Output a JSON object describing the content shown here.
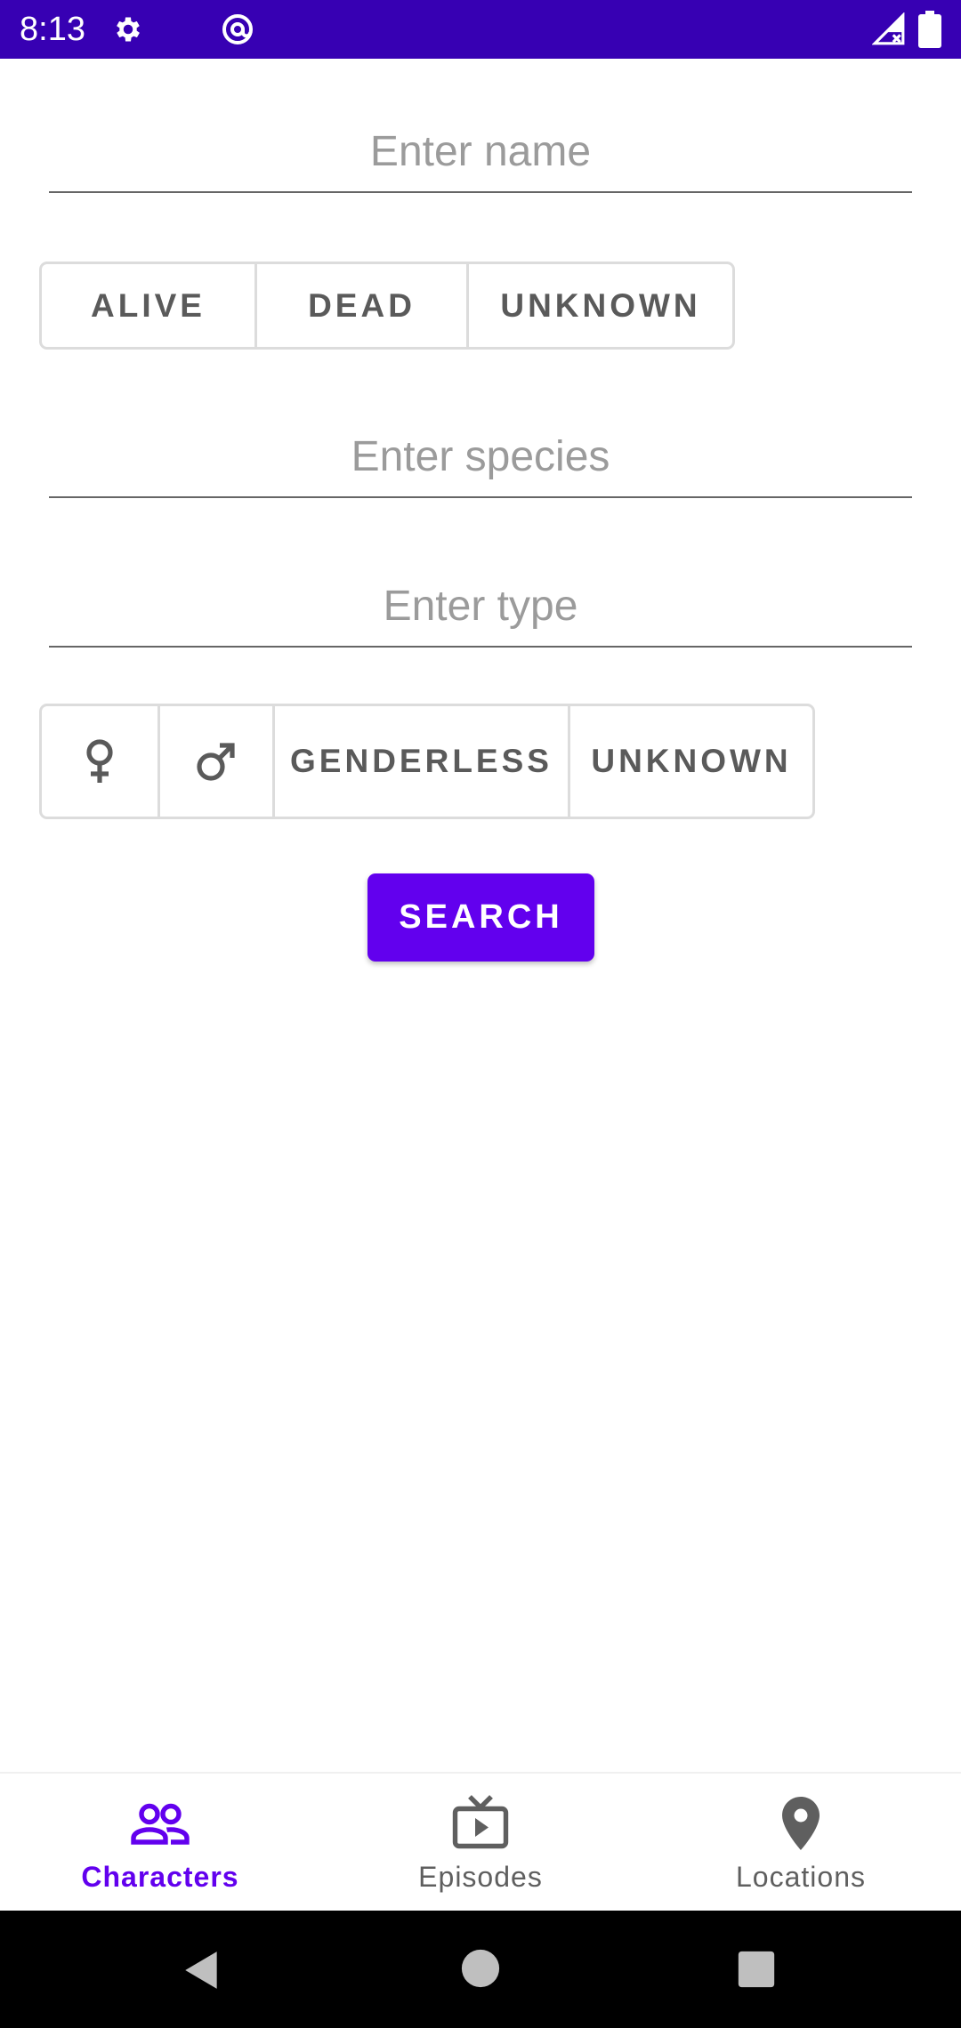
{
  "status_bar": {
    "time": "8:13",
    "icons": [
      "gear-icon",
      "at-sign-icon",
      "signal-icon",
      "battery-icon"
    ],
    "background": "#3700b3"
  },
  "form": {
    "name_placeholder": "Enter name",
    "status_options": [
      "ALIVE",
      "DEAD",
      "UNKNOWN"
    ],
    "species_placeholder": "Enter species",
    "type_placeholder": "Enter type",
    "gender_options": [
      {
        "icon": "female-icon"
      },
      {
        "icon": "male-icon"
      },
      {
        "label": "GENDERLESS"
      },
      {
        "label": "UNKNOWN"
      }
    ],
    "search_label": "SEARCH"
  },
  "bottom_nav": {
    "items": [
      {
        "label": "Characters",
        "icon": "people-icon",
        "active": true
      },
      {
        "label": "Episodes",
        "icon": "tv-play-icon",
        "active": false
      },
      {
        "label": "Locations",
        "icon": "map-pin-icon",
        "active": false
      }
    ]
  },
  "colors": {
    "accent": "#6200ee",
    "status_bar": "#3700b3",
    "inactive": "#5f5f5f"
  }
}
